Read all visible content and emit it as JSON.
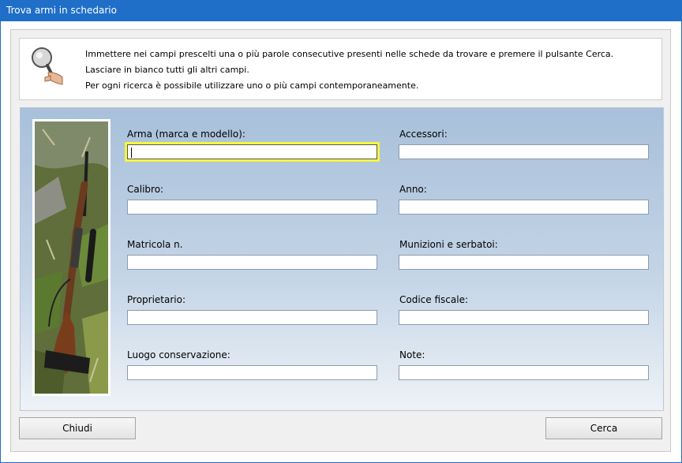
{
  "window": {
    "title": "Trova armi in schedario"
  },
  "info": {
    "lines": [
      "Immettere nei campi prescelti una o più parole consecutive presenti nelle schede da trovare e premere il pulsante Cerca.",
      "Lasciare in bianco tutti gli altri campi.",
      "Per ogni ricerca è possibile utilizzare uno o più campi contemporaneamente."
    ]
  },
  "fields": {
    "arma": {
      "label": "Arma (marca e modello):",
      "value": ""
    },
    "accessori": {
      "label": "Accessori:",
      "value": ""
    },
    "calibro": {
      "label": "Calibro:",
      "value": ""
    },
    "anno": {
      "label": "Anno:",
      "value": ""
    },
    "matricola": {
      "label": "Matricola n.",
      "value": ""
    },
    "munizioni": {
      "label": "Munizioni e serbatoi:",
      "value": ""
    },
    "proprietario": {
      "label": "Proprietario:",
      "value": ""
    },
    "codice_fiscale": {
      "label": "Codice fiscale:",
      "value": ""
    },
    "luogo": {
      "label": "Luogo conservazione:",
      "value": ""
    },
    "note": {
      "label": "Note:",
      "value": ""
    }
  },
  "buttons": {
    "chiudi": "Chiudi",
    "cerca": "Cerca"
  },
  "colors": {
    "titlebar": "#1f6fc9",
    "focus_highlight": "#f5f542"
  },
  "icons": {
    "info": "magnifier-icon",
    "photo": "rifle-photo"
  }
}
